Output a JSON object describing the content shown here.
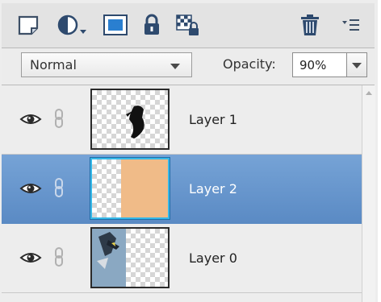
{
  "toolbar": {
    "tools": [
      {
        "icon": "new-layer-icon"
      },
      {
        "icon": "adjustment-layer-icon"
      },
      {
        "icon": "layer-mask-icon"
      },
      {
        "icon": "lock-all-icon"
      },
      {
        "icon": "lock-transparency-icon"
      },
      {
        "icon": "delete-layer-icon"
      },
      {
        "icon": "panel-menu-icon"
      }
    ]
  },
  "options": {
    "blend_mode": "Normal",
    "opacity_label": "Opacity:",
    "opacity_value": "90%"
  },
  "layers": [
    {
      "name": "Layer 1",
      "selected": false,
      "visible": true,
      "linked": false
    },
    {
      "name": "Layer 2",
      "selected": true,
      "visible": true,
      "linked": false,
      "fill": "#f0bb88"
    },
    {
      "name": "Layer 0",
      "selected": false,
      "visible": true,
      "linked": false
    }
  ],
  "colors": {
    "selection": "#5a8ac4",
    "thumb_highlight": "#35b8e8",
    "layer2_fill": "#f0bb88"
  }
}
